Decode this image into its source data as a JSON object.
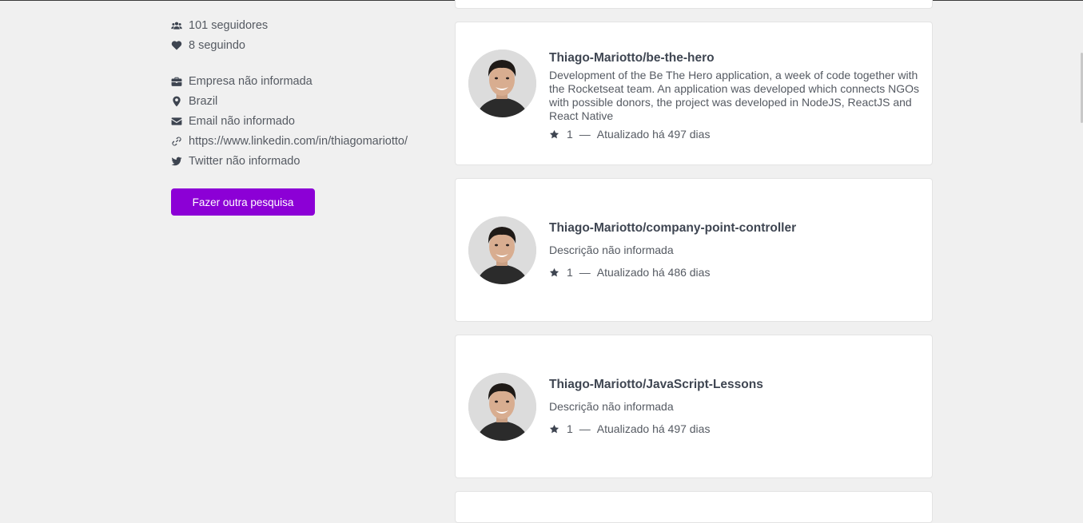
{
  "profile": {
    "followers": "101 seguidores",
    "following": "8 seguindo",
    "company": "Empresa não informada",
    "location": "Brazil",
    "email": "Email não informado",
    "website": "https://www.linkedin.com/in/thiagomariotto/",
    "twitter": "Twitter não informado",
    "search_again_label": "Fazer outra pesquisa"
  },
  "icons": {
    "followers": "users-icon",
    "following": "heart-icon",
    "company": "briefcase-icon",
    "location": "map-pin-icon",
    "email": "envelope-icon",
    "website": "link-icon",
    "twitter": "twitter-icon",
    "stars": "star-icon"
  },
  "colors": {
    "accent": "#8c00d6",
    "background": "#f0f0f0",
    "card": "#ffffff",
    "text": "#49505a"
  },
  "repos": [
    {
      "title": "Thiago-Mariotto/be-the-hero",
      "description": "Development of the Be The Hero application, a week of code together with the Rocketseat team. An application was developed which connects NGOs with possible donors, the project was developed in NodeJS, ReactJS and React Native",
      "stars": "1",
      "separator": "—",
      "updated": "Atualizado há 497 dias"
    },
    {
      "title": "Thiago-Mariotto/company-point-controller",
      "description": "Descrição não informada",
      "stars": "1",
      "separator": "—",
      "updated": "Atualizado há 486 dias"
    },
    {
      "title": "Thiago-Mariotto/JavaScript-Lessons",
      "description": "Descrição não informada",
      "stars": "1",
      "separator": "—",
      "updated": "Atualizado há 497 dias"
    }
  ]
}
